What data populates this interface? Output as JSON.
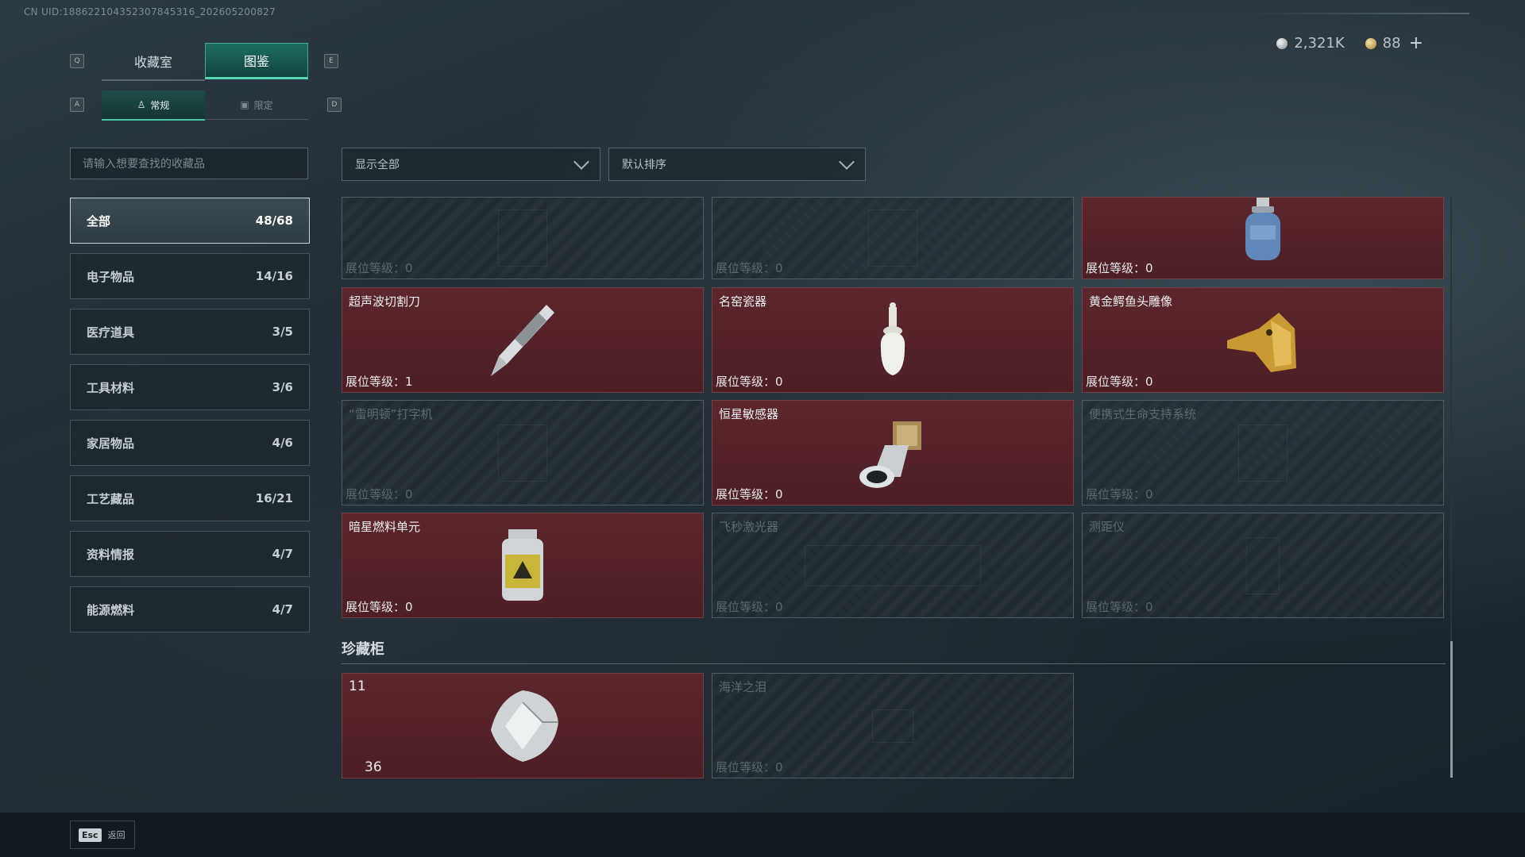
{
  "uid": "CN UID:18862210435230784531­6_202605200827",
  "currency": {
    "silver": "2,321K",
    "gold": "88",
    "plus": "+"
  },
  "keys": {
    "q": "Q",
    "e": "E",
    "a": "A",
    "d": "D"
  },
  "tabs": [
    {
      "label": "收藏室"
    },
    {
      "label": "图鉴"
    }
  ],
  "subtabs": [
    {
      "label": "常规"
    },
    {
      "label": "限定"
    }
  ],
  "search": {
    "placeholder": "请输入想要查找的收藏品"
  },
  "filters": {
    "show": "显示全部",
    "sort": "默认排序"
  },
  "categories": [
    {
      "label": "全部",
      "count": "48/68"
    },
    {
      "label": "电子物品",
      "count": "14/16"
    },
    {
      "label": "医疗道具",
      "count": "3/5"
    },
    {
      "label": "工具材料",
      "count": "3/6"
    },
    {
      "label": "家居物品",
      "count": "4/6"
    },
    {
      "label": "工艺藏品",
      "count": "16/21"
    },
    {
      "label": "资料情报",
      "count": "4/7"
    },
    {
      "label": "能源燃料",
      "count": "4/7"
    }
  ],
  "items": [
    {
      "name": "",
      "level": "展位等级：0",
      "owned": false,
      "icon": "unknown-relic-icon"
    },
    {
      "name": "",
      "level": "展位等级：0",
      "owned": false,
      "icon": "unknown-device-icon"
    },
    {
      "name": "",
      "level": "展位等级：0",
      "owned": true,
      "icon": "gas-canister-icon"
    },
    {
      "name": "超声波切割刀",
      "level": "展位等级：1",
      "owned": true,
      "icon": "ultrasonic-knife-icon"
    },
    {
      "name": "名窑瓷器",
      "level": "展位等级：0",
      "owned": true,
      "icon": "porcelain-vase-icon"
    },
    {
      "name": "黄金鳄鱼头雕像",
      "level": "展位等级：0",
      "owned": true,
      "icon": "gold-crocodile-icon"
    },
    {
      "name": "“雷明顿”打字机",
      "level": "展位等级：0",
      "owned": false,
      "icon": "typewriter-icon"
    },
    {
      "name": "恒星敏感器",
      "level": "展位等级：0",
      "owned": true,
      "icon": "star-sensor-icon"
    },
    {
      "name": "便携式生命支持系统",
      "level": "展位等级：0",
      "owned": false,
      "icon": "life-support-icon"
    },
    {
      "name": "暗星燃料单元",
      "level": "展位等级：0",
      "owned": true,
      "icon": "fuel-cell-icon"
    },
    {
      "name": "飞秒激光器",
      "level": "展位等级：0",
      "owned": false,
      "icon": "laser-icon"
    },
    {
      "name": "测距仪",
      "level": "展位等级：0",
      "owned": false,
      "icon": "rangefinder-icon"
    }
  ],
  "treasure": {
    "title": "珍藏柜",
    "items": [
      {
        "top": "11",
        "bottom": "36",
        "owned": true,
        "icon": "diamond-icon"
      },
      {
        "name": "海洋之泪",
        "level": "展位等级：0",
        "owned": false,
        "icon": "ocean-tear-icon"
      }
    ]
  },
  "footer": {
    "esc": "Esc",
    "back": "返回"
  }
}
